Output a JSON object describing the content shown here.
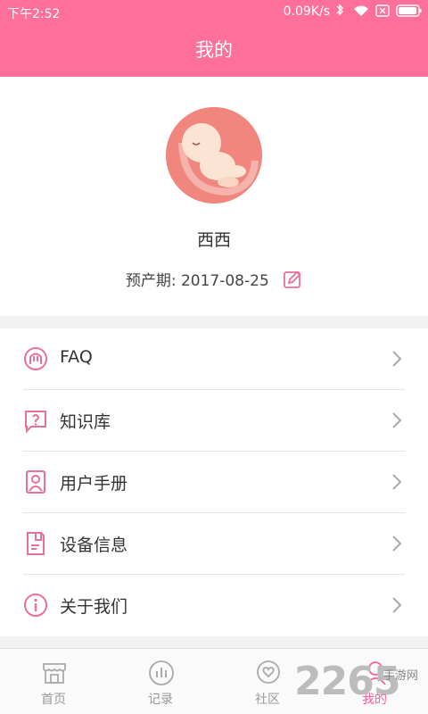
{
  "status_bar": {
    "time": "下午2:52",
    "network_speed": "0.09K/s",
    "icons": [
      "bluetooth-icon",
      "wifi-icon",
      "sim-off-icon",
      "battery-icon"
    ]
  },
  "header": {
    "title": "我的"
  },
  "profile": {
    "avatar": "baby-avatar",
    "nickname": "西西",
    "due_date_label": "预产期: 2017-08-25",
    "edit_icon": "edit-icon"
  },
  "menu": {
    "items": [
      {
        "label": "FAQ",
        "icon": "faq-icon"
      },
      {
        "label": "知识库",
        "icon": "question-chat-icon"
      },
      {
        "label": "用户手册",
        "icon": "user-manual-icon"
      },
      {
        "label": "设备信息",
        "icon": "device-info-icon"
      },
      {
        "label": "关于我们",
        "icon": "info-icon"
      }
    ]
  },
  "tabbar": {
    "tabs": [
      {
        "label": "首页",
        "icon": "home-store-icon",
        "active": false
      },
      {
        "label": "记录",
        "icon": "record-chart-icon",
        "active": false
      },
      {
        "label": "社区",
        "icon": "community-heart-icon",
        "active": false
      },
      {
        "label": "我的",
        "icon": "profile-icon",
        "active": true
      }
    ]
  },
  "watermark": {
    "number": "2265",
    "text": "手游网"
  },
  "colors": {
    "accent": "#ff6f9c",
    "icon_pink": "#e8709c",
    "active_tab": "#ff5f92",
    "inactive_tab": "#999999"
  }
}
